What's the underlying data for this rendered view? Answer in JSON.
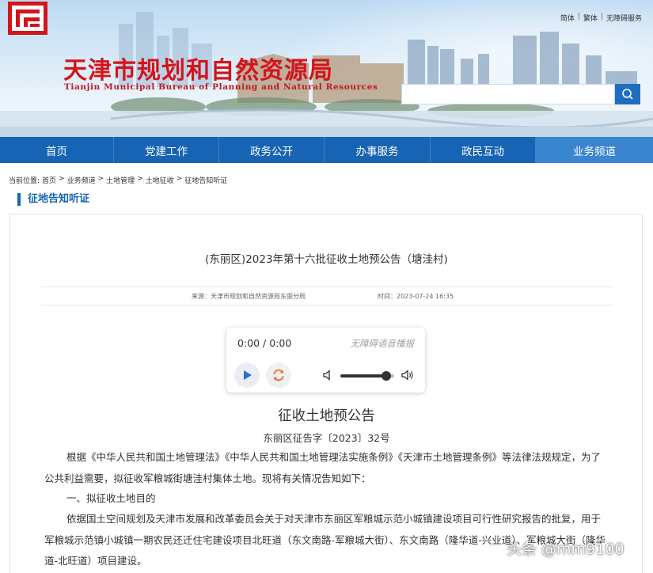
{
  "header": {
    "title": "天津市规划和自然资源局",
    "subtitle": "Tianjin Municipal Bureau of Planning and Natural Resources",
    "top_links": [
      "简体",
      "繁体",
      "无障碍服务"
    ],
    "search": {
      "placeholder": ""
    },
    "colors": {
      "title": "#d4141b",
      "nav": "#1764b4",
      "nav_active": "#3a85cf"
    }
  },
  "nav": {
    "items": [
      {
        "label": "首页",
        "active": false
      },
      {
        "label": "党建工作",
        "active": false
      },
      {
        "label": "政务公开",
        "active": false
      },
      {
        "label": "办事服务",
        "active": false
      },
      {
        "label": "政民互动",
        "active": false
      },
      {
        "label": "业务频道",
        "active": true
      }
    ]
  },
  "breadcrumb": {
    "prefix": "当前位置:",
    "items": [
      "首页",
      "业务频道",
      "土地管理",
      "土地征收",
      "征地告知听证"
    ]
  },
  "section": {
    "title": "征地告知听证"
  },
  "article": {
    "title": "(东丽区)2023年第十六批征收土地预公告（塘洼村)",
    "source": "来源：天津市规划和自然资源局东丽分局",
    "time": "时间：2023-07-24 16:35"
  },
  "player": {
    "time": "0:00 / 0:00",
    "tts_label": "无障碍语音播报",
    "play_icon": "play-icon",
    "loop_icon": "loop-icon",
    "volume": 0.9
  },
  "document": {
    "title": "征收土地预公告",
    "number": "东丽区征告字〔2023〕32号",
    "p1": "根据《中华人民共和国土地管理法》《中华人民共和国土地管理法实施条例》《天津市土地管理条例》等法律法规规定，为了公共利益需要，拟征收军粮城街塘洼村集体土地。现将有关情况告知如下：",
    "p2": "一、拟征收土地目的",
    "p3": "依据国土空间规划及天津市发展和改革委员会关于对天津市东丽区军粮城示范小城镇建设项目可行性研究报告的批复，用于军粮城示范镇小城镇一期农民还迁住宅建设项目北旺道（东文南路-军粮城大街）、东文南路（隆华道-兴业道）、军粮城大街（隆华道-北旺道）项目建设。"
  },
  "watermark": {
    "text": "头条 @mm9100"
  }
}
